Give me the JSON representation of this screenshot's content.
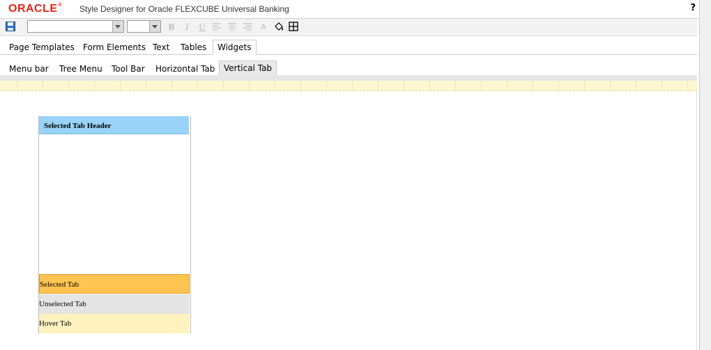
{
  "header": {
    "logo": "ORACLE",
    "title": "Style Designer for Oracle FLEXCUBE Universal Banking",
    "help": "?"
  },
  "toolbar": {
    "save_icon": "save-disk-icon",
    "font_family_value": "",
    "font_size_value": "",
    "format_buttons": [
      "B",
      "I",
      "U"
    ],
    "icons": [
      "align-left-icon",
      "align-center-icon",
      "align-right-icon",
      "font-color-icon",
      "fill-color-icon",
      "border-grid-icon"
    ]
  },
  "main_tabs": [
    "Page Templates",
    "Form Elements",
    "Text",
    "Tables",
    "Widgets"
  ],
  "main_tab_selected": "Widgets",
  "sub_tabs": [
    "Menu bar",
    "Tree Menu",
    "Tool Bar",
    "Horizontal Tab",
    "Vertical Tab"
  ],
  "sub_tab_selected": "Vertical Tab",
  "preview": {
    "header": "Selected Tab Header",
    "selected_tab": "Selected Tab",
    "unselected_tab": "Unselected Tab",
    "hover_tab": "Hover Tab",
    "colors": {
      "header_bg": "#99d3f7",
      "selected_bg": "#ffc451",
      "unselected_bg": "#e4e4e4",
      "hover_bg": "#fff2bf"
    }
  }
}
